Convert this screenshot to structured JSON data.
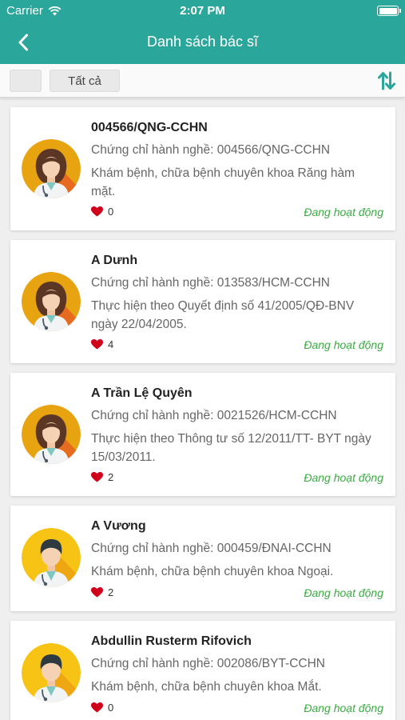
{
  "status_bar": {
    "carrier": "Carrier",
    "time": "2:07 PM"
  },
  "nav": {
    "title": "Danh sách bác sĩ"
  },
  "filter": {
    "all_label": "Tất cả"
  },
  "colors": {
    "primary": "#2aa69b",
    "active_status": "#3bab42",
    "heart": "#d0021b"
  },
  "doctors": [
    {
      "name": "004566/QNG-CCHN",
      "cert": "Chứng chỉ hành nghề: 004566/QNG-CCHN",
      "desc": "Khám bệnh, chữa bệnh chuyên khoa Răng hàm mặt.",
      "likes": "0",
      "status": "Đang hoạt động",
      "avatar": "female-doctor-icon"
    },
    {
      "name": "A Dưnh",
      "cert": "Chứng chỉ hành nghề: 013583/HCM-CCHN",
      "desc": "Thực hiện theo Quyết định số 41/2005/QĐ-BNV ngày 22/04/2005.",
      "likes": "4",
      "status": "Đang hoạt động",
      "avatar": "female-doctor-icon"
    },
    {
      "name": "A Trần Lệ Quyên",
      "cert": "Chứng chỉ hành nghề: 0021526/HCM-CCHN",
      "desc": "Thực hiện theo Thông tư số 12/2011/TT- BYT ngày 15/03/2011.",
      "likes": "2",
      "status": "Đang hoạt động",
      "avatar": "female-doctor-icon"
    },
    {
      "name": "A Vương",
      "cert": "Chứng chỉ hành nghề: 000459/ĐNAI-CCHN",
      "desc": "Khám bệnh, chữa bệnh chuyên khoa Ngoại.",
      "likes": "2",
      "status": "Đang hoạt động",
      "avatar": "male-doctor-icon"
    },
    {
      "name": "Abdullin Rusterm Rifovich",
      "cert": "Chứng chỉ hành nghề: 002086/BYT-CCHN",
      "desc": "Khám bệnh, chữa bệnh chuyên khoa Mắt.",
      "likes": "0",
      "status": "Đang hoạt động",
      "avatar": "male-doctor-icon"
    }
  ]
}
